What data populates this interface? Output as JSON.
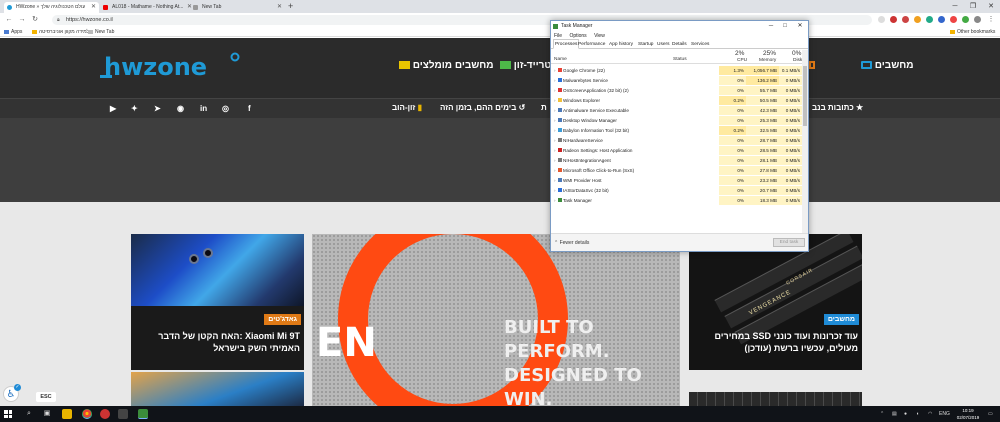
{
  "browser": {
    "tabs": [
      {
        "label": "HWzone » עולם הטכנולוגיה שלך"
      },
      {
        "label": "AL018 - Mathame - Nothing At..."
      },
      {
        "label": "New Tab"
      }
    ],
    "new_tab_label": "+",
    "url": "https://hwzone.co.il",
    "bookmarks": {
      "apps": "Apps",
      "item1": "למידה מקוון אוניברסיטה",
      "item2": "New Tab",
      "other": "Other bookmarks"
    }
  },
  "site": {
    "logo_text": "hwzone",
    "menu": {
      "computers": "מחשבים",
      "trade_zone": "טרייד-זון",
      "recommended": "מחשבים מומלצים"
    },
    "subnav": {
      "authors": "כתובות בנב",
      "days": "בימים ההם, בזמן הזה",
      "zoneweb": "זון-הוב",
      "partial": "ת"
    },
    "cards": {
      "left": {
        "category": "גאדג'טים",
        "title": "Xiaomi Mi 9T :האח הקטן של הדבר האמיתי השק בישראל"
      },
      "center": {
        "slogan_line1": "BUILT TO PERFORM.",
        "slogan_line2": "DESIGNED TO WIN.",
        "partial": "EN"
      },
      "right": {
        "category": "מחשבים",
        "title": "עוד זכרונות ועוד כונני SSD במחירים מעולים, עכשיו ברשת (עודכן)",
        "brand1": "CORSAIR",
        "brand2": "VENGEANCE"
      }
    },
    "esc_label": "ESC"
  },
  "task_manager": {
    "title": "Task Manager",
    "menu": [
      "File",
      "Options",
      "View"
    ],
    "tabs": [
      "Processes",
      "Performance",
      "App history",
      "Startup",
      "Users",
      "Details",
      "Services"
    ],
    "columns": {
      "name": "Name",
      "status": "Status",
      "cpu_pct": "2%",
      "cpu": "CPU",
      "mem_pct": "25%",
      "mem": "Memory",
      "disk_pct": "0%",
      "disk": "Disk"
    },
    "rows": [
      {
        "name": "Google Chrome (22)",
        "cpu": "1.3%",
        "mem": "1,056.7 MB",
        "disk": "0.1 MB/s",
        "icon": "#e94235"
      },
      {
        "name": "Malwarebytes Service",
        "cpu": "0%",
        "mem": "136.2 MB",
        "disk": "0 MB/s",
        "icon": "#2a6ed8"
      },
      {
        "name": "OnScreenApplication (32 bit) (2)",
        "cpu": "0%",
        "mem": "55.7 MB",
        "disk": "0 MB/s",
        "icon": "#d33"
      },
      {
        "name": "Windows Explorer",
        "cpu": "0.2%",
        "mem": "50.5 MB",
        "disk": "0 MB/s",
        "icon": "#f2c037"
      },
      {
        "name": "Antimalware Service Executable",
        "cpu": "0%",
        "mem": "42.3 MB",
        "disk": "0 MB/s",
        "icon": "#4a78b8"
      },
      {
        "name": "Desktop Window Manager",
        "cpu": "0%",
        "mem": "25.3 MB",
        "disk": "0 MB/s",
        "icon": "#4a78b8"
      },
      {
        "name": "Babylon Information Tool (32 bit)",
        "cpu": "0.2%",
        "mem": "32.5 MB",
        "disk": "0 MB/s",
        "icon": "#3a9bd8"
      },
      {
        "name": "NIHardwareService",
        "cpu": "0%",
        "mem": "28.7 MB",
        "disk": "0 MB/s",
        "icon": "#777"
      },
      {
        "name": "Radeon Settings: Host Application",
        "cpu": "0%",
        "mem": "28.5 MB",
        "disk": "0 MB/s",
        "icon": "#c22"
      },
      {
        "name": "NIHostIntegrationAgent",
        "cpu": "0%",
        "mem": "28.1 MB",
        "disk": "0 MB/s",
        "icon": "#777"
      },
      {
        "name": "Microsoft Office Click-to-Run (SxS)",
        "cpu": "0%",
        "mem": "27.8 MB",
        "disk": "0 MB/s",
        "icon": "#e4572e"
      },
      {
        "name": "WMI Provider Host",
        "cpu": "0%",
        "mem": "23.2 MB",
        "disk": "0 MB/s",
        "icon": "#4a78b8"
      },
      {
        "name": "IAStorDataSvc (32 bit)",
        "cpu": "0%",
        "mem": "20.7 MB",
        "disk": "0 MB/s",
        "icon": "#2a6ed8"
      },
      {
        "name": "Task Manager",
        "cpu": "0%",
        "mem": "18.3 MB",
        "disk": "0 MB/s",
        "icon": "#3b8c3b"
      }
    ],
    "fewer_details": "Fewer details",
    "end_task": "End task"
  },
  "taskbar": {
    "language": "ENG",
    "time": "10:19",
    "date": "02/07/2019"
  },
  "colors": {
    "header_bg": "#2b2b2b",
    "accent_blue": "#1f8bd6",
    "accent_orange": "#e07a16",
    "logo_blue": "#1f9ad6"
  }
}
